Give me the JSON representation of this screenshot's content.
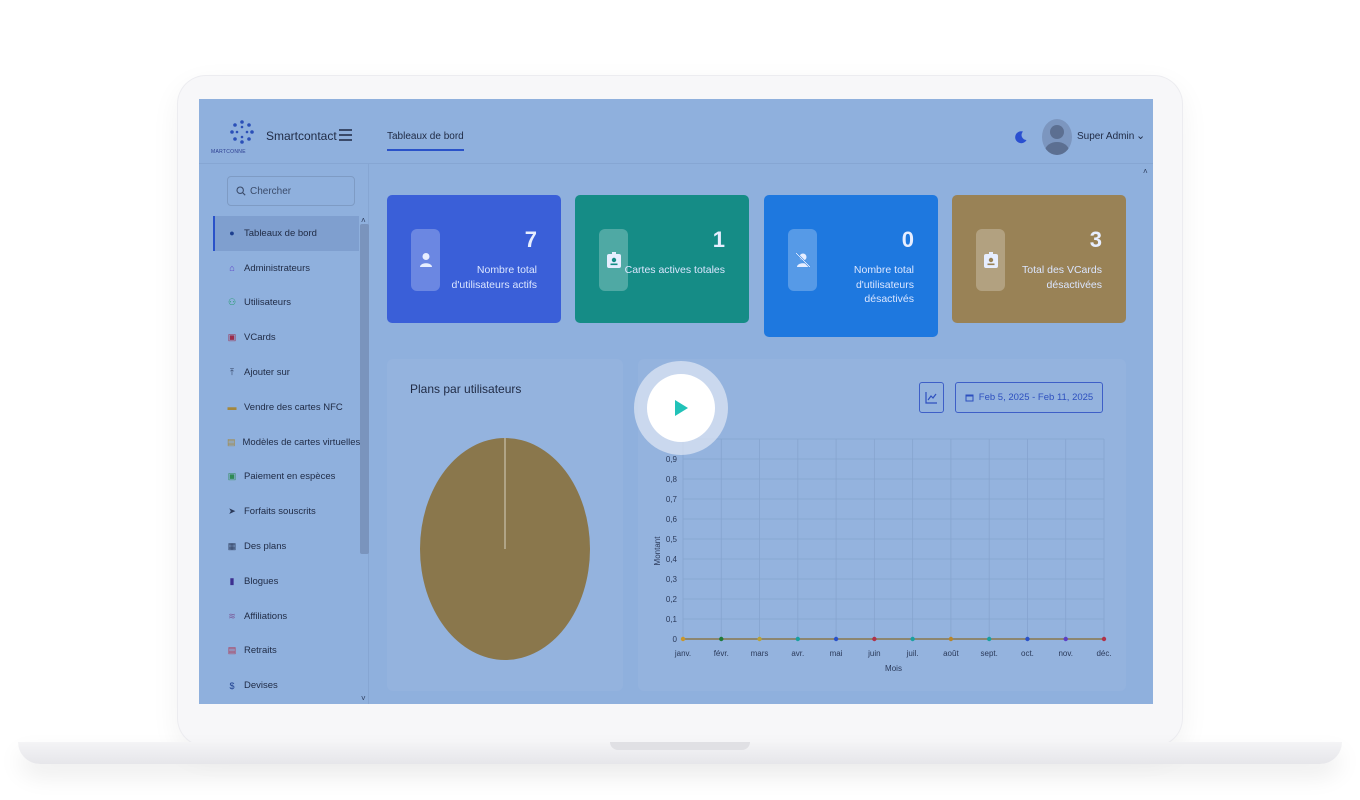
{
  "app": {
    "brand": "Smartcontact",
    "logo_text": "MARTCONNE"
  },
  "header": {
    "active_tab": "Tableaux de bord",
    "user_name": "Super Admin"
  },
  "sidebar": {
    "search_placeholder": "Chercher",
    "items": [
      {
        "label": "Tableaux de bord",
        "icon": "dashboard-icon",
        "color": "#1d3f8f"
      },
      {
        "label": "Administrateurs",
        "icon": "admin-icon",
        "color": "#5b3fc7"
      },
      {
        "label": "Utilisateurs",
        "icon": "users-icon",
        "color": "#1f9a6a"
      },
      {
        "label": "VCards",
        "icon": "vcard-icon",
        "color": "#9b2b4a"
      },
      {
        "label": "Ajouter sur",
        "icon": "upload-icon",
        "color": "#2b3a5a"
      },
      {
        "label": "Vendre des cartes NFC",
        "icon": "nfc-card-icon",
        "color": "#a4873c"
      },
      {
        "label": "Modèles de cartes virtuelles",
        "icon": "template-icon",
        "color": "#a4873c"
      },
      {
        "label": "Paiement en espèces",
        "icon": "cash-icon",
        "color": "#2f8a55"
      },
      {
        "label": "Forfaits souscrits",
        "icon": "send-icon",
        "color": "#2b3a5a"
      },
      {
        "label": "Des plans",
        "icon": "calendar-icon",
        "color": "#2b3a5a"
      },
      {
        "label": "Blogues",
        "icon": "book-icon",
        "color": "#3d2f8f"
      },
      {
        "label": "Affiliations",
        "icon": "coins-icon",
        "color": "#7a5b9a"
      },
      {
        "label": "Retraits",
        "icon": "receipt-icon",
        "color": "#b0324a"
      },
      {
        "label": "Devises",
        "icon": "dollar-icon",
        "color": "#1d3f8f"
      }
    ]
  },
  "stats": [
    {
      "value": "7",
      "label": "Nombre total d'utilisateurs actifs",
      "color": "#3a5fd8",
      "icon": "user-icon"
    },
    {
      "value": "1",
      "label": "Cartes actives totales",
      "color": "#158c86",
      "icon": "badge-icon"
    },
    {
      "value": "0",
      "label": "Nombre total d'utilisateurs désactivés",
      "color": "#1e78df",
      "icon": "user-slash-icon"
    },
    {
      "value": "3",
      "label": "Total des VCards désactivées",
      "color": "#998256",
      "icon": "badge-icon"
    }
  ],
  "panels": {
    "pie_title": "Plans par utilisateurs",
    "date_range": "Feb 5, 2025 - Feb 11, 2025"
  },
  "chart_data": [
    {
      "type": "pie",
      "title": "Plans par utilisateurs",
      "slices": [
        {
          "value": 1,
          "color": "#8a774c"
        }
      ]
    },
    {
      "type": "line",
      "xlabel": "Mois",
      "ylabel": "Montant",
      "categories": [
        "janv.",
        "févr.",
        "mars",
        "avr.",
        "mai",
        "juin",
        "juil.",
        "août",
        "sept.",
        "oct.",
        "nov.",
        "déc."
      ],
      "y_ticks": [
        "0",
        "0,1",
        "0,2",
        "0,3",
        "0,4",
        "0,5",
        "0,6",
        "0,7",
        "0,8",
        "0,9"
      ],
      "ylim": [
        0,
        1
      ],
      "grid": true,
      "series": [
        {
          "values": [
            0,
            0,
            0,
            0,
            0,
            0,
            0,
            0,
            0,
            0,
            0,
            0
          ],
          "colors": [
            "#c9962b",
            "#1f7a3a",
            "#b8a23a",
            "#1aa0a0",
            "#2a52c9",
            "#b0324a",
            "#1aa0a0",
            "#b8852a",
            "#1aa0a0",
            "#2a52c9",
            "#5b3fc7",
            "#b0324a"
          ]
        }
      ]
    }
  ]
}
